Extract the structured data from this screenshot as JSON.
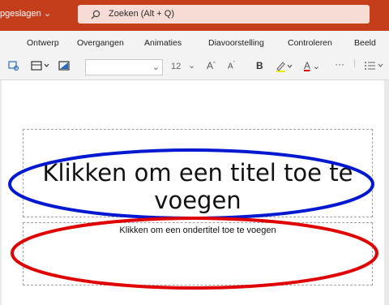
{
  "titlebar": {
    "saved_label": "pgeslagen",
    "search_placeholder": "Zoeken (Alt + Q)"
  },
  "tabs": [
    "Ontwerp",
    "Overgangen",
    "Animaties",
    "Diavoorstelling",
    "Controleren",
    "Beeld"
  ],
  "toolbar": {
    "font_name": "",
    "font_size": "12",
    "grow_font": "A",
    "shrink_font": "A",
    "bold": "B",
    "font_color": "A",
    "more": "···"
  },
  "slide": {
    "title_placeholder": "Klikken om een titel toe te voegen",
    "subtitle_placeholder": "Klikken om een ondertitel toe te voegen"
  },
  "annotations": {
    "title_ellipse_color": "#0018d0",
    "subtitle_ellipse_color": "#e00000"
  },
  "colors": {
    "titlebar_bg": "#c43e1c",
    "search_bg": "#f7dcd5"
  }
}
